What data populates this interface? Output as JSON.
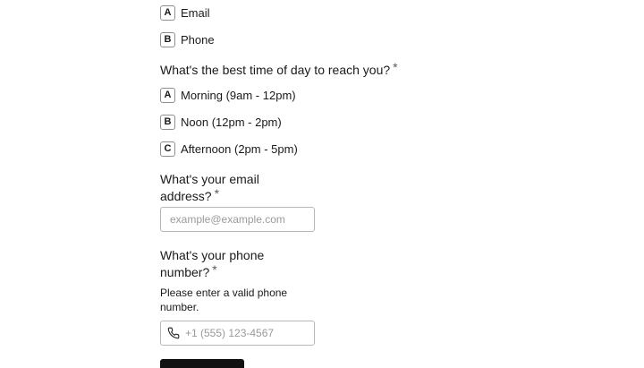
{
  "contact_method": {
    "options": [
      {
        "key": "A",
        "label": "Email"
      },
      {
        "key": "B",
        "label": "Phone"
      }
    ]
  },
  "time_of_day": {
    "question": "What's the best time of day to reach you?",
    "required_mark": "*",
    "options": [
      {
        "key": "A",
        "label": "Morning (9am - 12pm)"
      },
      {
        "key": "B",
        "label": "Noon (12pm - 2pm)"
      },
      {
        "key": "C",
        "label": "Afternoon (2pm - 5pm)"
      }
    ]
  },
  "email": {
    "question_line1": "What's your email",
    "question_line2": "address?",
    "required_mark": "*",
    "placeholder": "example@example.com"
  },
  "phone": {
    "question_line1": "What's your phone",
    "question_line2": "number?",
    "required_mark": "*",
    "helper_line1": "Please enter a valid phone",
    "helper_line2": "number.",
    "placeholder": "+1 (555) 123-4567",
    "icon": "phone-icon"
  },
  "colors": {
    "text": "#1a1a1a",
    "border": "#b8b8b8",
    "button": "#111111"
  }
}
